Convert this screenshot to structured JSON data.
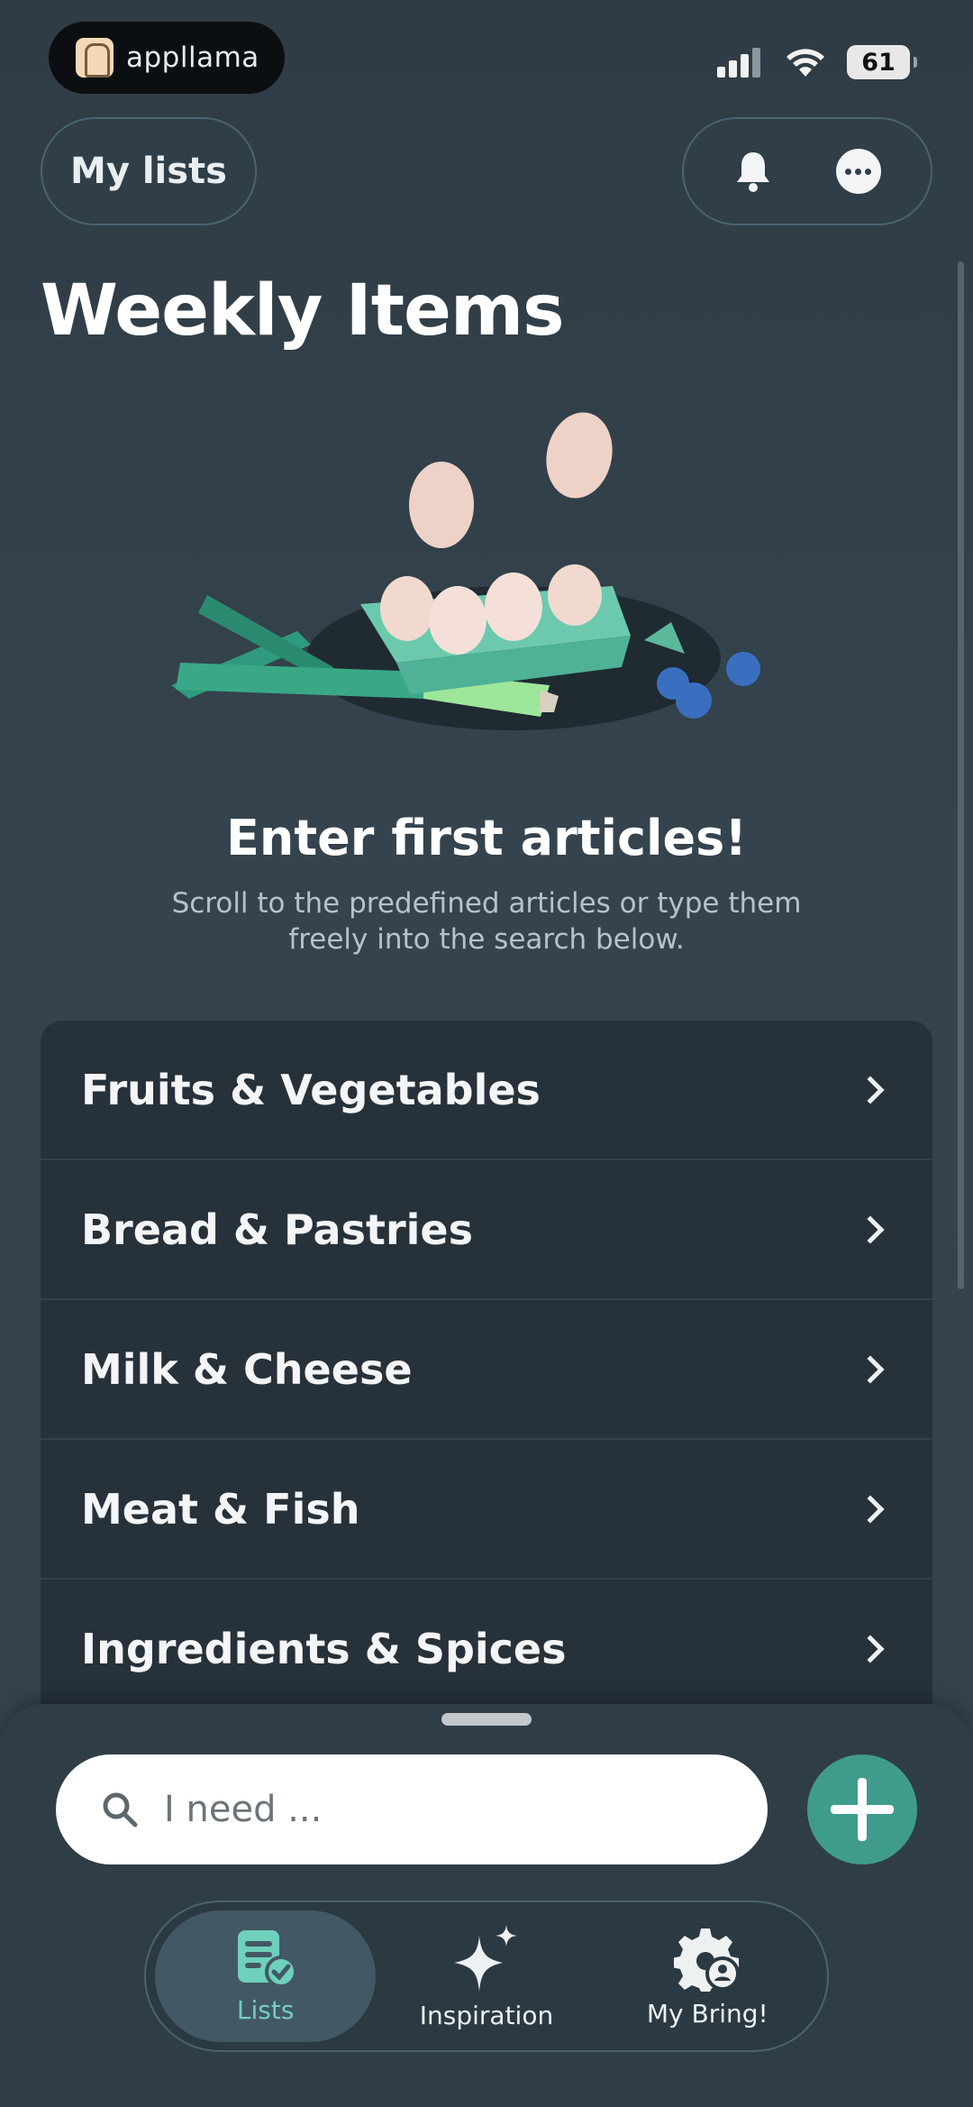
{
  "status_bar": {
    "app_name": "appllama",
    "battery": "61"
  },
  "header": {
    "my_lists_label": "My lists"
  },
  "page": {
    "title": "Weekly Items",
    "empty_heading": "Enter first articles!",
    "empty_sub": "Scroll to the predefined articles or type them freely into the search below."
  },
  "categories": [
    {
      "label": "Fruits & Vegetables"
    },
    {
      "label": "Bread & Pastries"
    },
    {
      "label": "Milk & Cheese"
    },
    {
      "label": "Meat & Fish"
    },
    {
      "label": "Ingredients & Spices"
    }
  ],
  "search": {
    "placeholder": "I need ..."
  },
  "tabs": [
    {
      "label": "Lists",
      "icon": "list-check-icon",
      "active": true
    },
    {
      "label": "Inspiration",
      "icon": "sparkle-icon",
      "active": false
    },
    {
      "label": "My Bring!",
      "icon": "gear-user-icon",
      "active": false
    }
  ],
  "colors": {
    "background": "#33414b",
    "accent": "#3f9c8d",
    "active_tab_text": "#6fd0bd"
  }
}
